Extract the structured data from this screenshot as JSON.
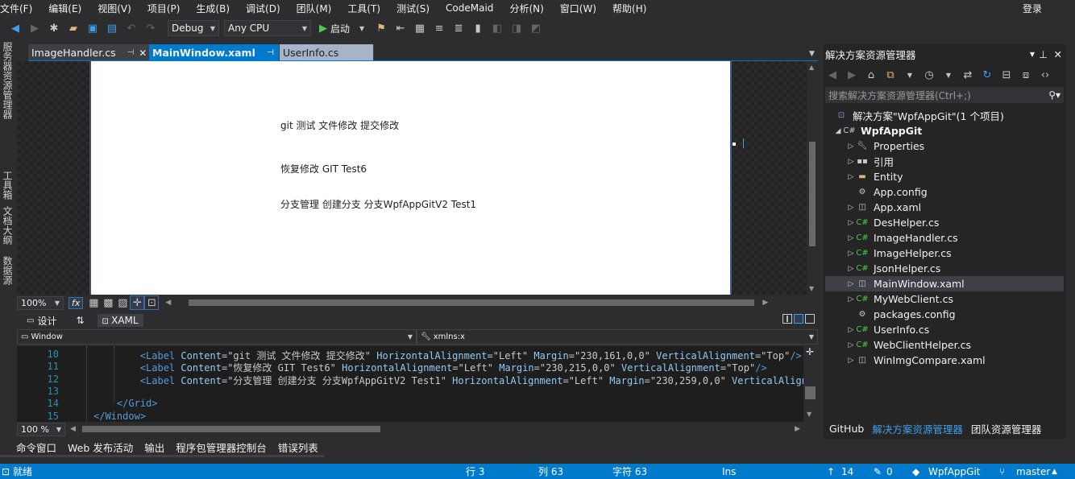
{
  "menu": [
    "文件(F)",
    "编辑(E)",
    "视图(V)",
    "项目(P)",
    "生成(B)",
    "调试(D)",
    "团队(M)",
    "工具(T)",
    "测试(S)",
    "CodeMaid",
    "分析(N)",
    "窗口(W)",
    "帮助(H)"
  ],
  "login": "登录",
  "toolbar": {
    "config": "Debug",
    "platform": "Any CPU",
    "start": "启动"
  },
  "left_strip": [
    "服务器资源管理器",
    "工具箱",
    "文档大纲",
    "数据源"
  ],
  "tabs": [
    {
      "label": "ImageHandler.cs",
      "active": false
    },
    {
      "label": "MainWindow.xaml",
      "active": true
    },
    {
      "label": "UserInfo.cs",
      "active": false
    }
  ],
  "designer": {
    "labels": [
      "git 测试 文件修改 提交修改",
      "恢复修改 GIT Test6",
      "分支管理 创建分支 分支WpfAppGitV2 Test1"
    ],
    "zoom": "100%",
    "fx": "fx"
  },
  "split": {
    "design": "设计",
    "swap": "⇅",
    "xaml": "XAML"
  },
  "nav": {
    "left": "Window",
    "right": "xmlns:x"
  },
  "code": {
    "lines": [
      {
        "n": "10",
        "indent": "        ",
        "content": "Label",
        "attrs": [
          [
            "Content",
            "git 测试 文件修改 提交修改"
          ],
          [
            "HorizontalAlignment",
            "Left"
          ],
          [
            "Margin",
            "230,161,0,0"
          ],
          [
            "VerticalAlignment",
            "Top"
          ]
        ],
        "close": "/>"
      },
      {
        "n": "11",
        "indent": "        ",
        "content": "Label",
        "attrs": [
          [
            "Content",
            "恢复修改 GIT Test6"
          ],
          [
            "HorizontalAlignment",
            "Left"
          ],
          [
            "Margin",
            "230,215,0,0"
          ],
          [
            "VerticalAlignment",
            "Top"
          ]
        ],
        "close": "/>"
      },
      {
        "n": "12",
        "indent": "        ",
        "content": "Label",
        "attrs": [
          [
            "Content",
            "分支管理 创建分支 分支WpfAppGitV2 Test1"
          ],
          [
            "HorizontalAlignment",
            "Left"
          ],
          [
            "Margin",
            "230,259,0,0"
          ],
          [
            "VerticalAlign",
            ""
          ]
        ],
        "close": ""
      },
      {
        "n": "13",
        "indent": "",
        "content": "",
        "attrs": [],
        "close": ""
      },
      {
        "n": "14",
        "indent": "    ",
        "content": "/Grid",
        "attrs": [],
        "close": ">"
      },
      {
        "n": "15",
        "indent": "",
        "content": "/Window",
        "attrs": [],
        "close": ">"
      }
    ],
    "zoom": "100 %"
  },
  "bottom_tabs": [
    "命令窗口",
    "Web 发布活动",
    "输出",
    "程序包管理器控制台",
    "错误列表"
  ],
  "status": {
    "ready": "就绪",
    "line": "行 3",
    "col": "列 63",
    "char": "字符 63",
    "mode": "Ins",
    "up": "14",
    "pencil": "0",
    "repo": "WpfAppGit",
    "branch": "master"
  },
  "solution": {
    "title": "解决方案资源管理器",
    "search": "搜索解决方案资源管理器(Ctrl+;)",
    "root": "解决方案\"WpfAppGit\"(1 个项目)",
    "project": "WpfAppGit",
    "items": [
      {
        "label": "Properties",
        "icon": "wrench",
        "arrow": true
      },
      {
        "label": "引用",
        "icon": "ref",
        "arrow": true
      },
      {
        "label": "Entity",
        "icon": "folder",
        "arrow": true
      },
      {
        "label": "App.config",
        "icon": "config",
        "arrow": false
      },
      {
        "label": "App.xaml",
        "icon": "xaml",
        "arrow": true
      },
      {
        "label": "DesHelper.cs",
        "icon": "cs",
        "arrow": true
      },
      {
        "label": "ImageHandler.cs",
        "icon": "cs",
        "arrow": true
      },
      {
        "label": "ImageHelper.cs",
        "icon": "cs",
        "arrow": true
      },
      {
        "label": "JsonHelper.cs",
        "icon": "cs",
        "arrow": true
      },
      {
        "label": "MainWindow.xaml",
        "icon": "xaml",
        "arrow": true,
        "selected": true
      },
      {
        "label": "MyWebClient.cs",
        "icon": "cs",
        "arrow": true
      },
      {
        "label": "packages.config",
        "icon": "config",
        "arrow": false
      },
      {
        "label": "UserInfo.cs",
        "icon": "cs",
        "arrow": true
      },
      {
        "label": "WebClientHelper.cs",
        "icon": "cs",
        "arrow": true
      },
      {
        "label": "WinImgCompare.xaml",
        "icon": "xaml",
        "arrow": true
      }
    ],
    "tabs": [
      "GitHub",
      "解决方案资源管理器",
      "团队资源管理器"
    ]
  },
  "colors": {
    "accent": "#007acc",
    "tab_active": "#007acc",
    "tab_inactive_bg": "#3f3f46"
  }
}
